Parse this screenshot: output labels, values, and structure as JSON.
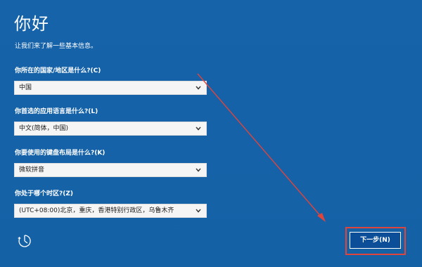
{
  "page": {
    "title": "你好",
    "subtitle": "让我们来了解一些基本信息。"
  },
  "fields": [
    {
      "label": "你所在的国家/地区是什么?(C)",
      "value": "中国"
    },
    {
      "label": "你首选的应用语言是什么?(L)",
      "value": "中文(简体，中国)"
    },
    {
      "label": "你要使用的键盘布局是什么?(K)",
      "value": "微软拼音"
    },
    {
      "label": "你处于哪个时区?(Z)",
      "value": "(UTC+08:00)北京，重庆，香港特别行政区，乌鲁木齐"
    }
  ],
  "footer": {
    "accessibility_icon": "ease-of-access-icon",
    "next_label": "下一步(N)"
  },
  "annotation": {
    "arrow_color": "#e0443b",
    "highlight_color": "#e0443b"
  }
}
